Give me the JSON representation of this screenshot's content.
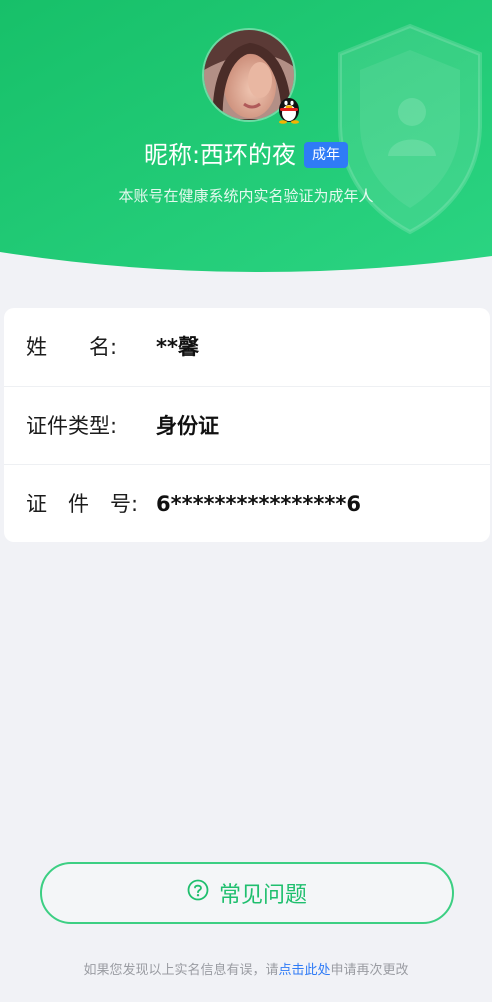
{
  "header": {
    "nickname_label": "昵称: ",
    "nickname": "西环的夜",
    "badge": "成年",
    "subtitle": "本账号在健康系统内实名验证为成年人"
  },
  "info": {
    "rows": [
      {
        "label": "姓　　名:",
        "value": "**馨"
      },
      {
        "label": "证件类型:",
        "value": "身份证"
      },
      {
        "label": "证　件　号:",
        "value": "6****************6"
      }
    ]
  },
  "faq": {
    "label": "常见问题"
  },
  "footer": {
    "prefix": "如果您发现以上实名信息有误，请",
    "link": "点击此处",
    "suffix": "申请再次更改"
  },
  "colors": {
    "green_primary": "#1fbf6e",
    "green_light": "#2fd27f",
    "badge_blue": "#2f7bf6",
    "page_bg": "#f1f2f6"
  },
  "icons": [
    "avatar-photo",
    "qq-penguin-icon",
    "shield-user-icon",
    "question-circle-icon"
  ]
}
